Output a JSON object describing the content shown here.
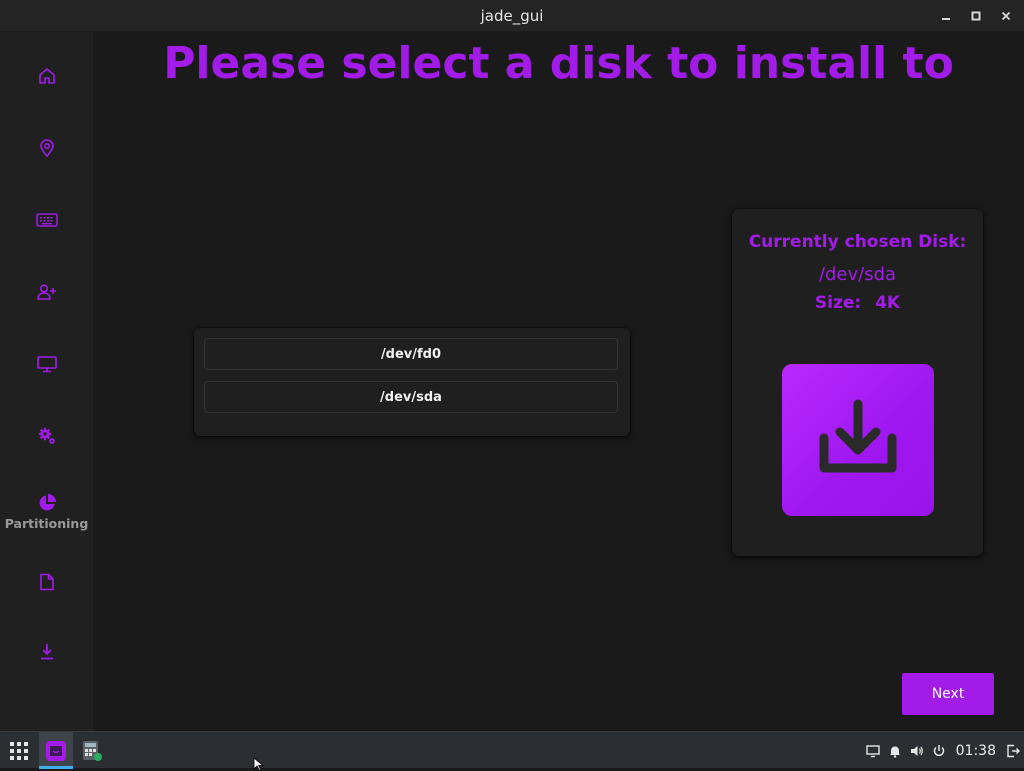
{
  "window": {
    "title": "jade_gui",
    "minimize_icon": "minimize-icon",
    "maximize_icon": "maximize-icon",
    "close_icon": "close-icon"
  },
  "sidebar": {
    "items": [
      {
        "icon": "home-icon",
        "label": ""
      },
      {
        "icon": "location-pin-icon",
        "label": ""
      },
      {
        "icon": "keyboard-icon",
        "label": ""
      },
      {
        "icon": "add-user-icon",
        "label": ""
      },
      {
        "icon": "monitor-icon",
        "label": ""
      },
      {
        "icon": "gears-icon",
        "label": ""
      },
      {
        "icon": "pie-chart-icon",
        "label": "Partitioning"
      },
      {
        "icon": "file-icon",
        "label": ""
      },
      {
        "icon": "download-icon",
        "label": ""
      }
    ],
    "accent_color": "#a21be8",
    "active_label_color": "#9a9a9a"
  },
  "main": {
    "heading": "Please select a disk to install to",
    "disks": [
      {
        "name": "/dev/fd0"
      },
      {
        "name": "/dev/sda"
      }
    ],
    "info": {
      "title": "Currently chosen Disk:",
      "disk": "/dev/sda",
      "size_label": "Size:",
      "size_value": "4K"
    },
    "install_icon": "download-icon",
    "next_label": "Next",
    "accent_color": "#a21be8"
  },
  "taskbar": {
    "launcher_icon": "app-grid-icon",
    "apps": [
      {
        "icon": "jade-gui-app-icon",
        "active": true
      },
      {
        "icon": "calculator-app-icon",
        "active": false
      }
    ],
    "tray": [
      "display-icon",
      "bell-icon",
      "volume-icon",
      "power-icon"
    ],
    "clock": "01:38",
    "logout_icon": "logout-icon"
  }
}
